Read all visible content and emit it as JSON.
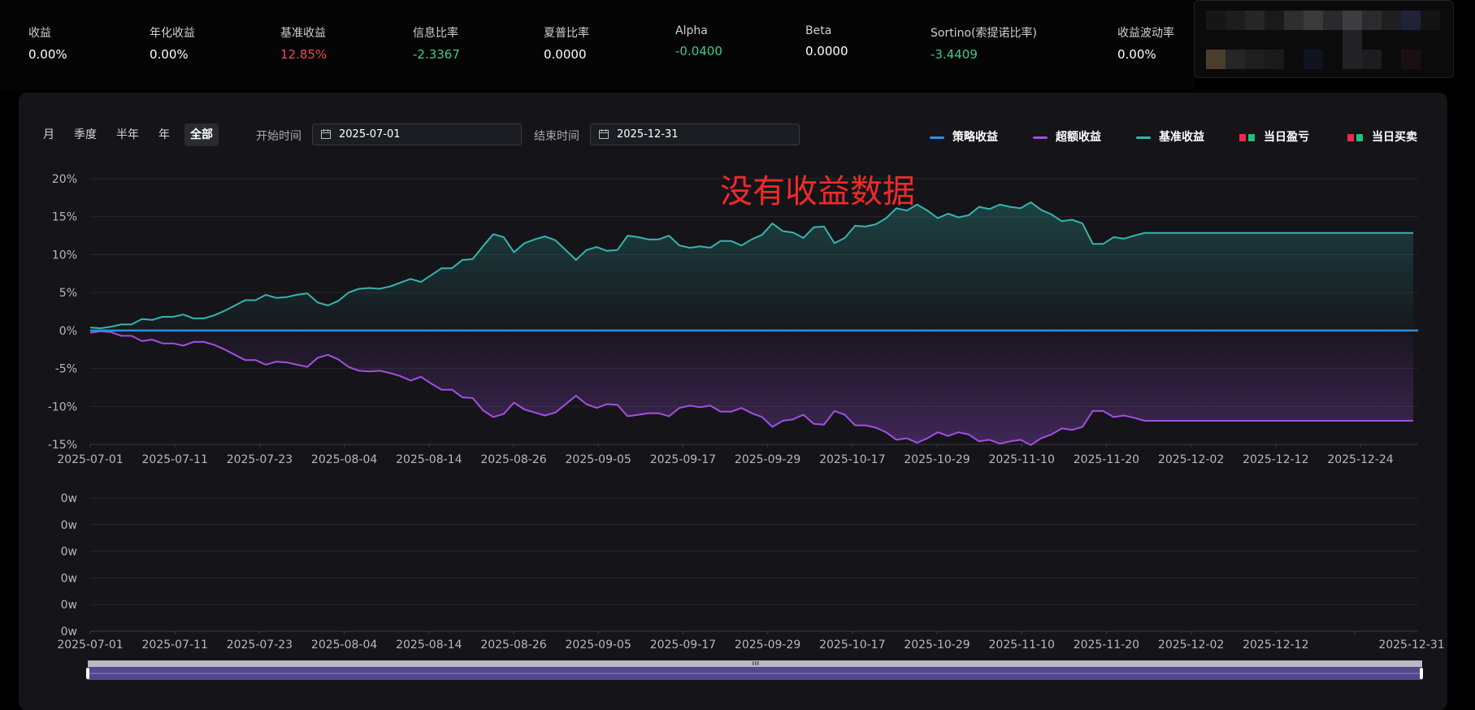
{
  "metrics": [
    {
      "label": "收益",
      "value": "0.00%",
      "color": "white"
    },
    {
      "label": "年化收益",
      "value": "0.00%",
      "color": "white"
    },
    {
      "label": "基准收益",
      "value": "12.85%",
      "color": "red"
    },
    {
      "label": "信息比率",
      "value": "-2.3367",
      "color": "green"
    },
    {
      "label": "夏普比率",
      "value": "0.0000",
      "color": "white"
    },
    {
      "label": "Alpha",
      "value": "-0.0400",
      "color": "green"
    },
    {
      "label": "Beta",
      "value": "0.0000",
      "color": "white"
    },
    {
      "label": "Sortino(索提诺比率)",
      "value": "-3.4409",
      "color": "green"
    },
    {
      "label": "收益波动率",
      "value": "0.00%",
      "color": "white"
    }
  ],
  "periods": [
    "月",
    "季度",
    "半年",
    "年",
    "全部"
  ],
  "active_period": "全部",
  "start": {
    "label": "开始时间",
    "value": "2025-07-01"
  },
  "end": {
    "label": "结束时间",
    "value": "2025-12-31"
  },
  "legend": [
    {
      "name": "策略收益",
      "color": "#2d8fe0",
      "kind": "line"
    },
    {
      "name": "超额收益",
      "color": "#a24fe0",
      "kind": "line"
    },
    {
      "name": "基准收益",
      "color": "#35b5ad",
      "kind": "line"
    },
    {
      "name": "当日盈亏",
      "colors": [
        "#f0284b",
        "#20c27a"
      ],
      "kind": "dual"
    },
    {
      "name": "当日买卖",
      "colors": [
        "#f0284b",
        "#20c27a"
      ],
      "kind": "dual"
    }
  ],
  "no_data_text": "没有收益数据",
  "colors": {
    "strategy": "#2d8fe0",
    "excess": "#a24fe0",
    "benchmark": "#35b5ad",
    "grid": "#26272d",
    "axis_text": "#b8b8bc"
  },
  "chart_data": [
    {
      "type": "line",
      "y_ticks": [
        "20%",
        "15%",
        "10%",
        "5%",
        "0%",
        "-5%",
        "-10%",
        "-15%"
      ],
      "ylim": [
        -15,
        20
      ],
      "x_ticks": [
        "2025-07-01",
        "2025-07-11",
        "2025-07-23",
        "2025-08-04",
        "2025-08-14",
        "2025-08-26",
        "2025-09-05",
        "2025-09-17",
        "2025-09-29",
        "2025-10-17",
        "2025-10-29",
        "2025-11-10",
        "2025-11-20",
        "2025-12-02",
        "2025-12-12",
        "2025-12-24"
      ],
      "series": [
        {
          "name": "基准收益",
          "values": [
            0.4,
            0.3,
            0.5,
            0.8,
            0.8,
            1.5,
            1.4,
            1.8,
            1.8,
            2.1,
            1.6,
            1.6,
            2.0,
            2.6,
            3.3,
            4.0,
            4.0,
            4.7,
            4.3,
            4.4,
            4.7,
            4.9,
            3.7,
            3.3,
            3.9,
            5.0,
            5.5,
            5.6,
            5.5,
            5.8,
            6.3,
            6.8,
            6.4,
            7.3,
            8.2,
            8.2,
            9.3,
            9.4,
            11.1,
            12.7,
            12.3,
            10.3,
            11.5,
            12.0,
            12.4,
            11.9,
            10.6,
            9.3,
            10.6,
            11.0,
            10.5,
            10.6,
            12.5,
            12.3,
            12.0,
            12.0,
            12.5,
            11.2,
            10.9,
            11.1,
            10.9,
            11.8,
            11.8,
            11.2,
            12.0,
            12.6,
            14.1,
            13.1,
            12.9,
            12.2,
            13.6,
            13.7,
            11.5,
            12.2,
            13.8,
            13.7,
            14.0,
            14.8,
            16.1,
            15.8,
            16.6,
            15.8,
            14.8,
            15.4,
            14.9,
            15.2,
            16.3,
            16.0,
            16.6,
            16.3,
            16.1,
            16.9,
            15.9,
            15.3,
            14.4,
            14.6,
            14.1,
            11.4,
            11.4,
            12.3,
            12.1,
            12.5,
            12.85,
            12.85,
            12.85,
            12.85,
            12.85,
            12.85,
            12.85,
            12.85,
            12.85,
            12.85,
            12.85,
            12.85,
            12.85,
            12.85,
            12.85,
            12.85,
            12.85,
            12.85,
            12.85,
            12.85,
            12.85,
            12.85,
            12.85,
            12.85,
            12.85,
            12.85,
            12.85
          ]
        },
        {
          "name": "超额收益",
          "values": [
            -0.3,
            -0.1,
            -0.2,
            -0.7,
            -0.7,
            -1.4,
            -1.2,
            -1.7,
            -1.7,
            -2.0,
            -1.5,
            -1.5,
            -1.9,
            -2.5,
            -3.2,
            -3.9,
            -3.9,
            -4.5,
            -4.1,
            -4.2,
            -4.5,
            -4.8,
            -3.6,
            -3.2,
            -3.8,
            -4.8,
            -5.3,
            -5.4,
            -5.3,
            -5.6,
            -6.0,
            -6.6,
            -6.1,
            -7.0,
            -7.8,
            -7.8,
            -8.8,
            -8.9,
            -10.5,
            -11.4,
            -11.0,
            -9.5,
            -10.4,
            -10.8,
            -11.2,
            -10.8,
            -9.7,
            -8.6,
            -9.7,
            -10.2,
            -9.7,
            -9.8,
            -11.3,
            -11.1,
            -10.9,
            -10.9,
            -11.3,
            -10.2,
            -9.9,
            -10.1,
            -9.9,
            -10.7,
            -10.7,
            -10.2,
            -10.9,
            -11.4,
            -12.7,
            -11.9,
            -11.7,
            -11.1,
            -12.3,
            -12.4,
            -10.6,
            -11.1,
            -12.5,
            -12.5,
            -12.8,
            -13.4,
            -14.4,
            -14.2,
            -14.8,
            -14.2,
            -13.4,
            -13.9,
            -13.4,
            -13.7,
            -14.6,
            -14.4,
            -14.9,
            -14.6,
            -14.4,
            -15.1,
            -14.2,
            -13.7,
            -12.9,
            -13.1,
            -12.7,
            -10.6,
            -10.6,
            -11.4,
            -11.2,
            -11.5,
            -11.9,
            -11.9,
            -11.9,
            -11.9,
            -11.9,
            -11.9,
            -11.9,
            -11.9,
            -11.9,
            -11.9,
            -11.9,
            -11.9,
            -11.9,
            -11.9,
            -11.9,
            -11.9,
            -11.9,
            -11.9,
            -11.9,
            -11.9,
            -11.9,
            -11.9,
            -11.9,
            -11.9,
            -11.9,
            -11.9,
            -11.9
          ]
        },
        {
          "name": "策略收益",
          "values": [
            0,
            0
          ]
        }
      ]
    },
    {
      "type": "bar",
      "y_ticks": [
        "0w",
        "0w",
        "0w",
        "0w",
        "0w",
        "0w"
      ],
      "x_ticks": [
        "2025-07-01",
        "2025-07-11",
        "2025-07-23",
        "2025-08-04",
        "2025-08-14",
        "2025-08-26",
        "2025-09-05",
        "2025-09-17",
        "2025-09-29",
        "2025-10-17",
        "2025-10-29",
        "2025-11-10",
        "2025-11-20",
        "2025-12-02",
        "2025-12-12",
        "2025-12-31"
      ],
      "series": []
    }
  ]
}
